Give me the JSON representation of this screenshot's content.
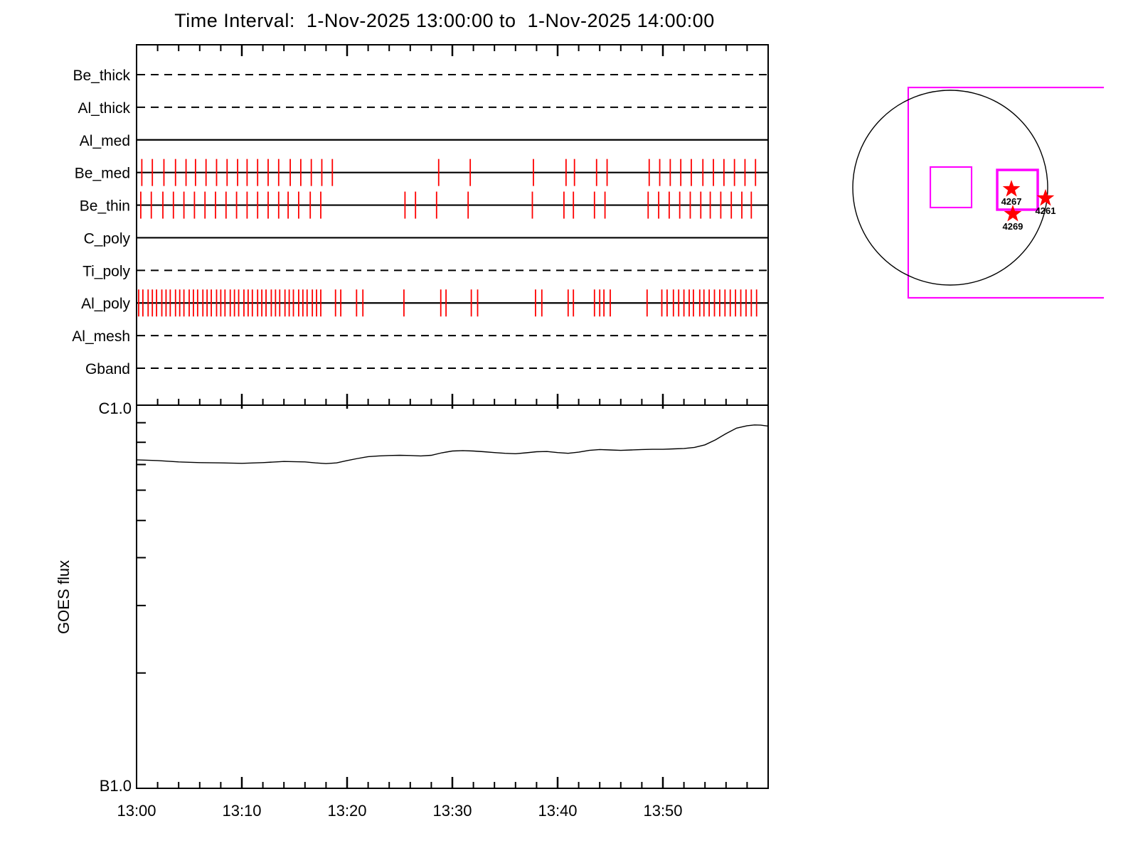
{
  "title": "Time Interval:  1-Nov-2025 13:00:00 to  1-Nov-2025 14:00:00",
  "colors": {
    "axis": "#000000",
    "exposure_tick": "#ff0000",
    "fov_box": "#ff00ff",
    "star": "#ff0000"
  },
  "chart_data": [
    {
      "id": "filter-exposure-timeline",
      "type": "scatter",
      "title": "XRT filter exposure timeline",
      "x_unit": "minutes after 13:00",
      "xlim": [
        0,
        60
      ],
      "x_major_tick_minutes": [
        10,
        20,
        30,
        40,
        50
      ],
      "x_minor_tick_step_min": 2,
      "rows": [
        {
          "label": "Be_thick",
          "style": "dashed",
          "exposures_min": []
        },
        {
          "label": "Al_thick",
          "style": "dashed",
          "exposures_min": []
        },
        {
          "label": "Al_med",
          "style": "solid",
          "exposures_min": []
        },
        {
          "label": "Be_med",
          "style": "solid",
          "exposures_min": [
            0.5,
            1.5,
            2.6,
            3.7,
            4.7,
            5.6,
            6.6,
            7.6,
            8.6,
            9.6,
            10.5,
            11.5,
            12.5,
            13.5,
            14.6,
            15.6,
            16.6,
            17.6,
            18.6,
            28.7,
            31.7,
            37.7,
            40.8,
            41.6,
            43.7,
            44.7,
            48.7,
            49.7,
            50.7,
            51.7,
            52.7,
            53.8,
            54.8,
            55.8,
            56.8,
            57.8,
            58.8
          ]
        },
        {
          "label": "Be_thin",
          "style": "solid",
          "exposures_min": [
            0.4,
            1.4,
            2.5,
            3.5,
            4.5,
            5.5,
            6.5,
            7.5,
            8.5,
            9.5,
            10.5,
            11.5,
            12.5,
            13.5,
            14.4,
            15.4,
            16.5,
            17.5,
            25.5,
            26.5,
            28.5,
            31.5,
            37.6,
            40.6,
            41.5,
            43.5,
            44.5,
            48.6,
            49.6,
            50.6,
            51.6,
            52.6,
            53.6,
            54.5,
            55.5,
            56.5,
            57.5,
            58.4
          ]
        },
        {
          "label": "C_poly",
          "style": "solid",
          "exposures_min": []
        },
        {
          "label": "Ti_poly",
          "style": "dashed",
          "exposures_min": []
        },
        {
          "label": "Al_poly",
          "style": "solid",
          "exposures_min": [
            0.2,
            0.6,
            1.1,
            1.5,
            1.9,
            2.4,
            2.8,
            3.2,
            3.7,
            4.1,
            4.5,
            5.0,
            5.4,
            5.8,
            6.3,
            6.7,
            7.1,
            7.6,
            8.0,
            8.4,
            8.9,
            9.3,
            9.7,
            10.2,
            10.6,
            11.0,
            11.5,
            11.9,
            12.3,
            12.8,
            13.2,
            13.6,
            14.1,
            14.5,
            14.9,
            15.4,
            15.8,
            16.2,
            16.7,
            17.1,
            17.5,
            18.9,
            19.4,
            20.9,
            21.5,
            25.4,
            28.9,
            29.4,
            31.8,
            32.4,
            37.9,
            38.5,
            41.0,
            41.5,
            43.5,
            44.0,
            44.4,
            45.0,
            48.5,
            49.9,
            50.4,
            51.0,
            51.5,
            52.0,
            52.5,
            52.9,
            53.5,
            53.9,
            54.4,
            54.9,
            55.4,
            55.9,
            56.4,
            56.9,
            57.4,
            57.9,
            58.4,
            58.9
          ]
        },
        {
          "label": "Al_mesh",
          "style": "dashed",
          "exposures_min": []
        },
        {
          "label": "Gband",
          "style": "dashed",
          "exposures_min": []
        }
      ]
    },
    {
      "id": "goes-flux",
      "type": "line",
      "ylabel": "GOES flux",
      "yaxis_top_label": "C1.0",
      "yaxis_bottom_label": "B1.0",
      "yscale": "log",
      "ylim_wm2": [
        1e-06,
        1e-05
      ],
      "x_tick_labels": [
        "13:00",
        "13:10",
        "13:20",
        "13:30",
        "13:40",
        "13:50"
      ],
      "series": [
        {
          "name": "GOES flux",
          "x_min": [
            0,
            2,
            4,
            6,
            8,
            10,
            12,
            14,
            16,
            17,
            18,
            19,
            20,
            21,
            22,
            23,
            24,
            25,
            26,
            27,
            28,
            29,
            30,
            31,
            32,
            33,
            34,
            35,
            36,
            37,
            38,
            39,
            40,
            41,
            42,
            43,
            44,
            45,
            46,
            47,
            48,
            49,
            50,
            51,
            52,
            53,
            54,
            55,
            56,
            57,
            58,
            58.7,
            59.3,
            60
          ],
          "flux_wm2": [
            7.2e-06,
            7.17e-06,
            7.11e-06,
            7.08e-06,
            7.07e-06,
            7.05e-06,
            7.08e-06,
            7.13e-06,
            7.11e-06,
            7.07e-06,
            7.04e-06,
            7.07e-06,
            7.17e-06,
            7.26e-06,
            7.34e-06,
            7.37e-06,
            7.39e-06,
            7.4e-06,
            7.39e-06,
            7.37e-06,
            7.4e-06,
            7.51e-06,
            7.59e-06,
            7.61e-06,
            7.59e-06,
            7.56e-06,
            7.52e-06,
            7.49e-06,
            7.47e-06,
            7.51e-06,
            7.56e-06,
            7.57e-06,
            7.52e-06,
            7.49e-06,
            7.54e-06,
            7.62e-06,
            7.66e-06,
            7.64e-06,
            7.62e-06,
            7.64e-06,
            7.66e-06,
            7.67e-06,
            7.67e-06,
            7.69e-06,
            7.71e-06,
            7.76e-06,
            7.88e-06,
            8.12e-06,
            8.43e-06,
            8.71e-06,
            8.84e-06,
            8.88e-06,
            8.87e-06,
            8.82e-06
          ]
        }
      ]
    },
    {
      "id": "solar-disk-map",
      "type": "scatter",
      "description": "Solar disk with instrument FOV boxes and flagged active regions",
      "active_regions": [
        {
          "label": "4267",
          "x_rsun": 0.628,
          "y_rsun": 0.015
        },
        {
          "label": "4261",
          "x_rsun": 0.978,
          "y_rsun": 0.109
        },
        {
          "label": "4269",
          "x_rsun": 0.642,
          "y_rsun": 0.27
        }
      ],
      "boxes": [
        {
          "id": "large-fov",
          "x1": -0.431,
          "y1": -1.029,
          "x2": 1.577,
          "y2": 1.131,
          "weight": "normal",
          "open_right": true
        },
        {
          "id": "center-target",
          "x1": -0.204,
          "y1": -0.212,
          "x2": 0.219,
          "y2": 0.204,
          "weight": "normal",
          "open_right": false
        },
        {
          "id": "ar-target",
          "x1": 0.482,
          "y1": -0.182,
          "x2": 0.898,
          "y2": 0.226,
          "weight": "bold",
          "open_right": false
        }
      ]
    }
  ]
}
